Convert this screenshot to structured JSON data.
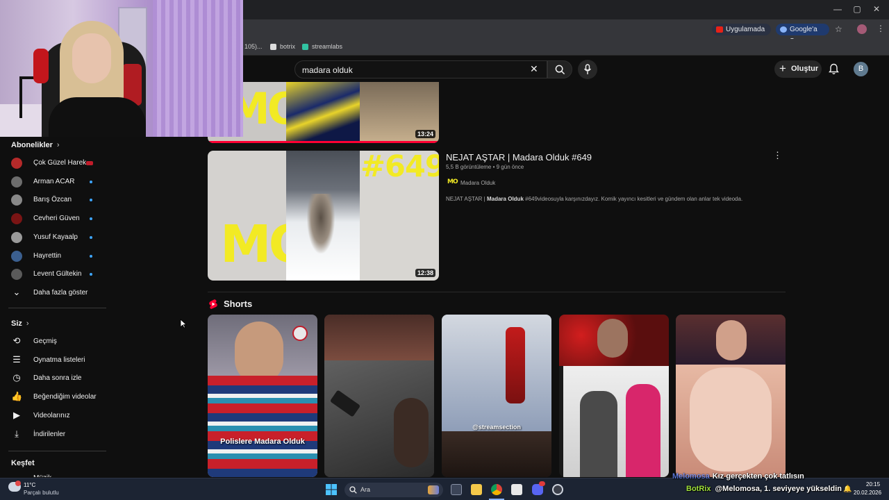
{
  "browser": {
    "window_controls": {
      "minimize": "—",
      "maximize": "▢",
      "close": "✕"
    },
    "address_bar": {
      "app_chip": "Uygulamada aç",
      "google_chip": "Google'a Sor"
    },
    "bookmarks": [
      "105)...",
      "botrix",
      "streamlabs"
    ]
  },
  "youtube_header": {
    "search_value": "madara olduk",
    "create_label": "Oluştur",
    "avatar_letter": "B"
  },
  "sidebar": {
    "subscriptions_title": "Abonelikler",
    "subscriptions": [
      {
        "name": "Çok Güzel Harek...",
        "color": "#b52a2a",
        "live": true
      },
      {
        "name": "Arman ACAR",
        "color": "#6d6d6d",
        "live": false
      },
      {
        "name": "Barış Özcan",
        "color": "#888888",
        "live": false
      },
      {
        "name": "Cevheri Güven",
        "color": "#7a1414",
        "live": false
      },
      {
        "name": "Yusuf Kayaalp",
        "color": "#9a9a9a",
        "live": false
      },
      {
        "name": "Hayrettin",
        "color": "#3b5f8f",
        "live": false
      },
      {
        "name": "Levent Gültekin",
        "color": "#5a5a5a",
        "live": false
      }
    ],
    "show_more": "Daha fazla göster",
    "you_title": "Siz",
    "you_items": [
      {
        "label": "Geçmiş",
        "icon": "history-icon"
      },
      {
        "label": "Oynatma listeleri",
        "icon": "playlists-icon"
      },
      {
        "label": "Daha sonra izle",
        "icon": "watch-later-icon"
      },
      {
        "label": "Beğendiğim videolar",
        "icon": "liked-icon"
      },
      {
        "label": "Videolarınız",
        "icon": "your-videos-icon"
      },
      {
        "label": "İndirilenler",
        "icon": "downloads-icon"
      }
    ],
    "explore_title": "Keşfet",
    "explore_partial": "Müzik"
  },
  "results": {
    "top_video": {
      "duration": "13:24",
      "progress_fraction": 1.0
    },
    "video": {
      "title": "NEJAT AŞTAR | Madara Olduk #649",
      "views": "5,5 B görüntüleme",
      "age": "9 gün önce",
      "channel": "Madara Olduk",
      "desc_prefix": "NEJAT AŞTAR | ",
      "desc_bold": "Madara Olduk",
      "desc_suffix": " #649videosuyla karşınızdayız. Komik yayıncı kesitleri ve gündem olan anlar tek videoda.",
      "duration": "12:38",
      "thumb_number": "#649",
      "logo_text": "MO"
    },
    "shorts_title": "Shorts",
    "shorts": [
      {
        "caption": "Polislere Madara Olduk"
      },
      {
        "caption": ""
      },
      {
        "caption": "@streamsection"
      },
      {
        "caption": ""
      },
      {
        "caption": ""
      }
    ]
  },
  "chat_overlay": {
    "line1_user": "Melomosa",
    "line1_text": "Kız gerçekten çok tatlısın",
    "line2_user": "BotRix",
    "line2_text": "@Melomosa, 1. seviyeye yükseldin"
  },
  "taskbar": {
    "weather_temp": "11°C",
    "weather_desc": "Parçalı bulutlu",
    "search_label": "Ara",
    "time": "20:15",
    "date": "20.02.2026"
  }
}
